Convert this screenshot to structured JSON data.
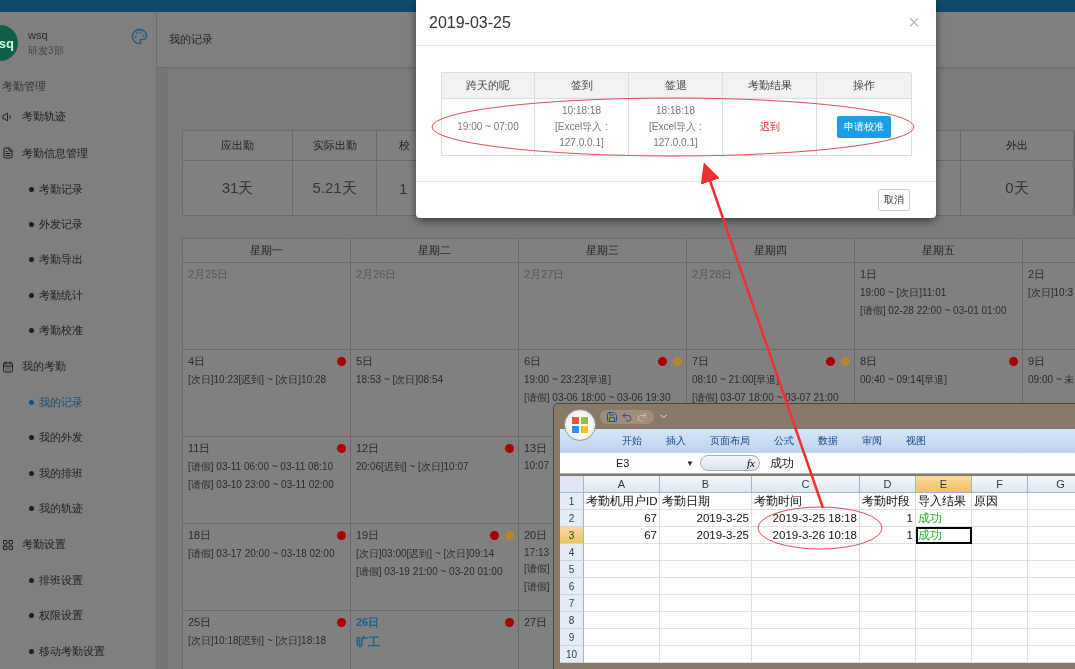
{
  "sidebar": {
    "user": {
      "avatar": "sq",
      "name": "wsq",
      "dept": "研发3部"
    },
    "section": "考勤管理",
    "items": [
      {
        "label": "考勤轨迹",
        "selected": false
      },
      {
        "label": "考勤信息管理",
        "selected": false,
        "children": [
          {
            "label": "考勤记录",
            "selected": false
          },
          {
            "label": "外发记录",
            "selected": false
          },
          {
            "label": "考勤导出",
            "selected": false
          },
          {
            "label": "考勤统计",
            "selected": false
          },
          {
            "label": "考勤校准",
            "selected": false
          }
        ]
      },
      {
        "label": "我的考勤",
        "selected": false,
        "children": [
          {
            "label": "我的记录",
            "selected": true
          },
          {
            "label": "我的外发",
            "selected": false
          },
          {
            "label": "我的排班",
            "selected": false
          },
          {
            "label": "我的轨迹",
            "selected": false
          }
        ]
      },
      {
        "label": "考勤设置",
        "selected": false,
        "children": [
          {
            "label": "排班设置",
            "selected": false
          },
          {
            "label": "权限设置",
            "selected": false
          },
          {
            "label": "移动考勤设置",
            "selected": false
          }
        ]
      }
    ]
  },
  "breadcrumb": "我的记录",
  "stats": [
    {
      "label": "应出勤",
      "value": "31天"
    },
    {
      "label": "实际出勤",
      "value": "5.21天"
    },
    {
      "label": "校",
      "value": "1"
    },
    {
      "label": "外出",
      "value": "0天"
    }
  ],
  "calendar": {
    "weekdays": [
      "星期一",
      "星期二",
      "星期三",
      "星期四",
      "星期五"
    ],
    "weeks": [
      [
        {
          "day": "2月25日",
          "other_month": true,
          "today": false
        },
        {
          "day": "2月26日",
          "other_month": true,
          "today": false
        },
        {
          "day": "2月27日",
          "other_month": true,
          "today": false
        },
        {
          "day": "2月28日",
          "other_month": true,
          "today": false
        },
        {
          "day": "1日",
          "other_month": false,
          "today": false,
          "lines": [
            "19:00 ~ [次日]11:01",
            "[请假] 02-28 22:00 ~ 03-01 01:00"
          ]
        },
        {
          "day": "2日",
          "other_month": false,
          "today": false,
          "lines": [
            "[次日]10:3"
          ]
        }
      ],
      [
        {
          "day": "4日",
          "other_month": false,
          "today": false,
          "dots": [
            {
              "color": "#a80000"
            }
          ],
          "lines": [
            "[次日]10:23[迟到] ~ [次日]10:28"
          ]
        },
        {
          "day": "5日",
          "other_month": false,
          "today": false,
          "lines": [
            "18:53 ~ [次日]08:54"
          ]
        },
        {
          "day": "6日",
          "other_month": false,
          "today": false,
          "dots": [
            {
              "color": "#a80000"
            },
            {
              "color": "#b8862e"
            }
          ],
          "lines": [
            "19:00 ~ 23:23[早退]",
            "[请假] 03-06 18:00 ~ 03-06 19:30"
          ]
        },
        {
          "day": "7日",
          "other_month": false,
          "today": false,
          "dots": [
            {
              "color": "#a80000"
            },
            {
              "color": "#b8862e"
            }
          ],
          "lines": [
            "08:10 ~ 21:00[早退]",
            "[请假] 03-07 18:00 ~ 03-07 21:00"
          ]
        },
        {
          "day": "8日",
          "other_month": false,
          "today": false,
          "dots": [
            {
              "color": "#a80000"
            }
          ],
          "lines": [
            "00:40 ~ 09:14[早退]"
          ]
        },
        {
          "day": "9日",
          "other_month": false,
          "today": false,
          "lines": [
            "09:00 ~ 未"
          ]
        }
      ],
      [
        {
          "day": "11日",
          "other_month": false,
          "today": false,
          "dots": [
            {
              "color": "#a80000"
            }
          ],
          "lines": [
            "[请假] 03-11 06:00 ~ 03-11 08:10",
            "[请假] 03-10 23:00 ~ 03-11 02:00"
          ]
        },
        {
          "day": "12日",
          "other_month": false,
          "today": false,
          "dots": [
            {
              "color": "#a80000"
            }
          ],
          "lines": [
            "20:06[迟到] ~ [次日]10:07"
          ]
        },
        {
          "day": "13日",
          "other_month": false,
          "today": false,
          "lines": [
            "10:07"
          ]
        }
      ],
      [
        {
          "day": "18日",
          "other_month": false,
          "today": false,
          "dots": [
            {
              "color": "#a80000"
            }
          ],
          "lines": [
            "[请假] 03-17 20:00 ~ 03-18 02:00"
          ]
        },
        {
          "day": "19日",
          "other_month": false,
          "today": false,
          "dots": [
            {
              "color": "#a80000"
            },
            {
              "color": "#b8862e"
            }
          ],
          "lines": [
            "[次日]03:00[迟到] ~ [次日]09:14",
            "[请假] 03-19 21:00 ~ 03-20 01:00"
          ]
        },
        {
          "day": "20日",
          "other_month": false,
          "today": false,
          "lines": [
            "17:13",
            "[请假]",
            "[请假]"
          ]
        }
      ],
      [
        {
          "day": "25日",
          "other_month": false,
          "today": false,
          "dots": [
            {
              "color": "#a80000"
            }
          ],
          "lines": [
            "[次日]10:18[迟到] ~ [次日]18:18"
          ]
        },
        {
          "day": "26日",
          "other_month": false,
          "today": true,
          "dots": [
            {
              "color": "#a80000"
            }
          ],
          "status": "旷工"
        },
        {
          "day": "27日",
          "other_month": false,
          "today": false
        }
      ]
    ]
  },
  "modal": {
    "title": "2019-03-25",
    "close": "×",
    "columns": [
      "跨天的呢",
      "签到",
      "签退",
      "考勤结果",
      "操作"
    ],
    "rows": [
      [
        {
          "kind": "text",
          "lines": [
            "19:00 ~ 07:00"
          ]
        },
        {
          "kind": "text",
          "lines": [
            "10:18:18",
            "[Excel导入 :",
            "127.0.0.1]"
          ]
        },
        {
          "kind": "text",
          "lines": [
            "18:18:18",
            "[Excel导入 :",
            "127.0.0.1]"
          ]
        },
        {
          "kind": "late",
          "lines": [
            "迟到"
          ]
        },
        {
          "kind": "button",
          "lines": [
            "申请校准"
          ]
        }
      ]
    ],
    "cancel": "取消"
  },
  "excel": {
    "ribbon_tabs": [
      "开始",
      "插入",
      "页面布局",
      "公式",
      "数据",
      "审阅",
      "视图"
    ],
    "name_box": "E3",
    "name_box_arrow": "▼",
    "function_label": "fx",
    "formula": "成功",
    "columns": [
      {
        "label": "A",
        "selected": false
      },
      {
        "label": "B",
        "selected": false
      },
      {
        "label": "C",
        "selected": false
      },
      {
        "label": "D",
        "selected": false
      },
      {
        "label": "E",
        "selected": true
      },
      {
        "label": "F",
        "selected": false
      },
      {
        "label": "G",
        "selected": false
      }
    ],
    "rows": [
      {
        "label": "1",
        "selected": false,
        "cells": [
          {
            "kind": "text",
            "text": "考勤机用户ID",
            "active": false
          },
          {
            "kind": "text",
            "text": "考勤日期",
            "active": false
          },
          {
            "kind": "text",
            "text": "考勤时间",
            "active": false
          },
          {
            "kind": "text",
            "text": "考勤时段",
            "active": false
          },
          {
            "kind": "text",
            "text": "导入结果",
            "active": false
          },
          {
            "kind": "text",
            "text": "原因",
            "active": false
          }
        ]
      },
      {
        "label": "2",
        "selected": false,
        "cells": [
          {
            "kind": "number",
            "text": "67",
            "active": false
          },
          {
            "kind": "number",
            "text": "2019-3-25",
            "active": false
          },
          {
            "kind": "number",
            "text": "2019-3-25 18:18",
            "active": false
          },
          {
            "kind": "number",
            "text": "1",
            "active": false
          },
          {
            "kind": "status",
            "text": "成功",
            "active": false
          }
        ]
      },
      {
        "label": "3",
        "selected": true,
        "cells": [
          {
            "kind": "number",
            "text": "67",
            "active": false
          },
          {
            "kind": "number",
            "text": "2019-3-25",
            "active": false
          },
          {
            "kind": "number",
            "text": "2019-3-26 10:18",
            "active": false
          },
          {
            "kind": "number",
            "text": "1",
            "active": false
          },
          {
            "kind": "status",
            "text": "成功",
            "active": true
          }
        ]
      },
      {
        "label": "4",
        "selected": false
      },
      {
        "label": "5",
        "selected": false
      },
      {
        "label": "6",
        "selected": false
      },
      {
        "label": "7",
        "selected": false
      },
      {
        "label": "8",
        "selected": false
      },
      {
        "label": "9",
        "selected": false
      },
      {
        "label": "10",
        "selected": false
      }
    ]
  }
}
